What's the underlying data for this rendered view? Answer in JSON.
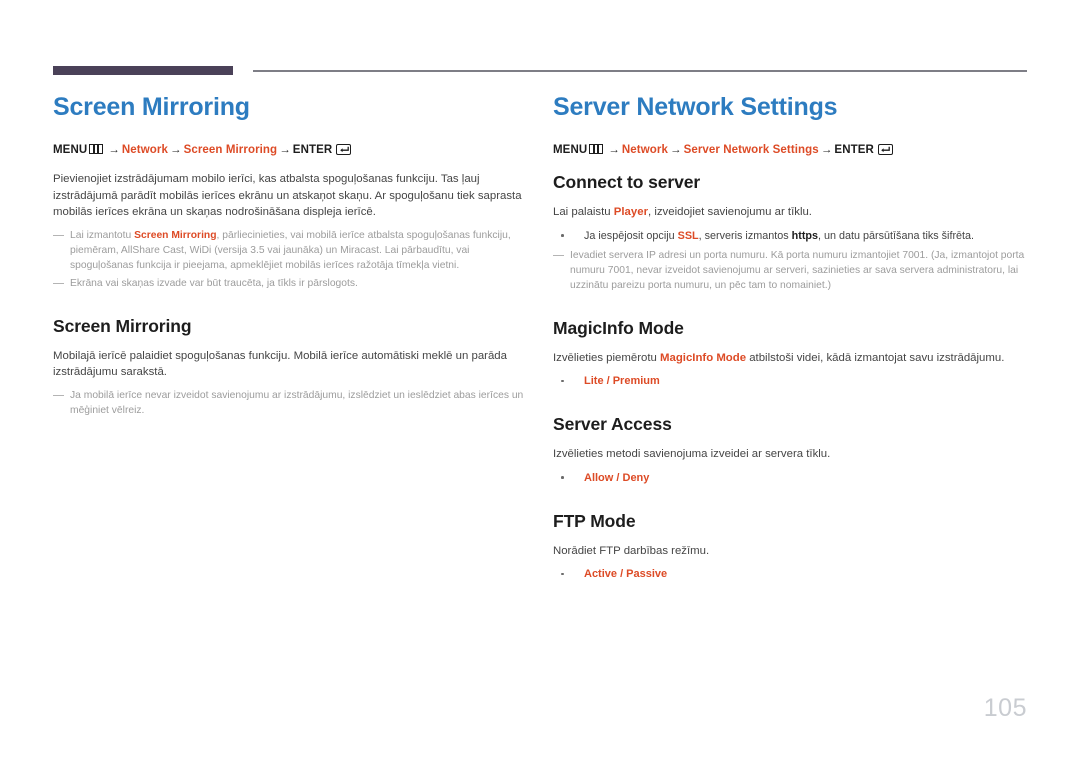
{
  "document": {
    "page_number": "105",
    "accent_color": "#dd4b26",
    "heading_color": "#2d7cc0",
    "rule_color": "#4a4158"
  },
  "left_column": {
    "title": "Screen Mirroring",
    "menu_path": {
      "menu_label": "MENU",
      "menu_icon": "menu-panel-icon",
      "arrow": "→",
      "step1": "Network",
      "step2": "Screen Mirroring",
      "enter_label": "ENTER",
      "enter_icon": "enter-return-icon"
    },
    "intro_paragraph": "Pievienojiet izstrādājumam mobilo ierīci, kas atbalsta spoguļošanas funkciju. Tas ļauj izstrādājumā parādīt mobilās ierīces ekrānu un atskaņot skaņu. Ar spoguļošanu tiek saprasta mobilās ierīces ekrāna un skaņas nodrošināšana displeja ierīcē.",
    "notes": [
      {
        "prefix": "Lai izmantotu ",
        "accent": "Screen Mirroring",
        "suffix": ", pārliecinieties, vai mobilā ierīce atbalsta spoguļošanas funkciju, piemēram, AllShare Cast, WiDi (versija 3.5 vai jaunāka) un Miracast. Lai pārbaudītu, vai spoguļošanas funkcija ir pieejama, apmeklējiet mobilās ierīces ražotāja tīmekļa vietni."
      },
      {
        "prefix": "Ekrāna vai skaņas izvade var būt traucēta, ja tīkls ir pārslogots.",
        "accent": "",
        "suffix": ""
      }
    ],
    "section": {
      "heading": "Screen Mirroring",
      "body": "Mobilajā ierīcē palaidiet spoguļošanas funkciju. Mobilā ierīce automātiski meklē un parāda izstrādājumu sarakstā.",
      "note": "Ja mobilā ierīce nevar izveidot savienojumu ar izstrādājumu, izslēdziet un ieslēdziet abas ierīces un mēģiniet vēlreiz."
    }
  },
  "right_column": {
    "title": "Server Network Settings",
    "menu_path": {
      "menu_label": "MENU",
      "menu_icon": "menu-panel-icon",
      "arrow": "→",
      "step1": "Network",
      "step2": "Server Network Settings",
      "enter_label": "ENTER",
      "enter_icon": "enter-return-icon"
    },
    "sections": [
      {
        "heading": "Connect to server",
        "body_prefix": "Lai palaistu ",
        "body_accent": "Player",
        "body_suffix": ", izveidojiet savienojumu ar tīklu.",
        "bullet_prefix": "Ja iespējosit opciju ",
        "bullet_accent": "SSL",
        "bullet_mid": ", serveris izmantos ",
        "bullet_strong": "https",
        "bullet_suffix": ", un datu pārsūtīšana tiks šifrēta.",
        "note": "Ievadiet servera IP adresi un porta numuru. Kā porta numuru izmantojiet 7001. (Ja, izmantojot porta numuru 7001, nevar izveidot savienojumu ar serveri, sazinieties ar sava servera administratoru, lai uzzinātu pareizu porta numuru, un pēc tam to nomainiet.)"
      },
      {
        "heading": "MagicInfo Mode",
        "body_prefix": "Izvēlieties piemērotu ",
        "body_accent": "MagicInfo Mode",
        "body_suffix": " atbilstoši videi, kādā izmantojat savu izstrādājumu.",
        "options": "Lite / Premium"
      },
      {
        "heading": "Server Access",
        "body": "Izvēlieties metodi savienojuma izveidei ar servera tīklu.",
        "options": "Allow / Deny"
      },
      {
        "heading": "FTP Mode",
        "body": "Norādiet FTP darbības režīmu.",
        "options": "Active / Passive"
      }
    ]
  }
}
